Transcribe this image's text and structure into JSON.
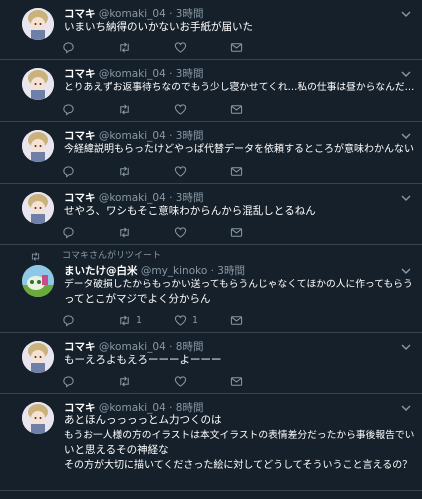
{
  "tweets": [
    {
      "name": "コマキ",
      "handle": "@komaki_04",
      "sep": "·",
      "time": "3時間",
      "lines": [
        "いまいち納得のいかないお手紙が届いた"
      ],
      "reply_count": "",
      "retweet_count": "",
      "like_count": ""
    },
    {
      "name": "コマキ",
      "handle": "@komaki_04",
      "sep": "·",
      "time": "3時間",
      "lines": [
        "とりあえずお返事待ちなのでもう少し寝かせてくれ…私の仕事は昼からなんだ…"
      ],
      "reply_count": "",
      "retweet_count": "",
      "like_count": ""
    },
    {
      "name": "コマキ",
      "handle": "@komaki_04",
      "sep": "·",
      "time": "3時間",
      "lines": [
        "今経緯説明もらったけどやっぱ代替データを依頼するところが意味わかんない"
      ],
      "reply_count": "",
      "retweet_count": "",
      "like_count": ""
    },
    {
      "name": "コマキ",
      "handle": "@komaki_04",
      "sep": "·",
      "time": "3時間",
      "lines": [
        "せやろ、ワシもそこ意味わからんから混乱しとるねん"
      ],
      "reply_count": "",
      "retweet_count": "",
      "like_count": ""
    },
    {
      "retweeted_by": "コマキさんがリツイート",
      "name": "まいたけ@白米",
      "handle": "@my_kinoko",
      "sep": "·",
      "time": "3時間",
      "lines": [
        "データ破損したからもっかい送ってもらうんじゃなくてほかの人に作ってもらう",
        "ってとこがマジでよく分からん"
      ],
      "reply_count": "",
      "retweet_count": "1",
      "like_count": "1"
    },
    {
      "name": "コマキ",
      "handle": "@komaki_04",
      "sep": "·",
      "time": "8時間",
      "lines": [
        "もーえろよもえろーーーよーーー"
      ],
      "reply_count": "",
      "retweet_count": "",
      "like_count": ""
    },
    {
      "name": "コマキ",
      "handle": "@komaki_04",
      "sep": "·",
      "time": "8時間",
      "lines": [
        "あとほんっっっっとム力つくのは",
        "もうお一人様の方のイラストは本文イラストの表情差分だったから事後報告でい",
        "いと思えるその神経な",
        "その方が大切に描いてくださった絵に対してどうしてそういうこと言えるの？"
      ],
      "reply_count": "",
      "retweet_count": "",
      "like_count": ""
    }
  ],
  "icons": {
    "caret": "chevron-down-icon",
    "reply": "reply-icon",
    "retweet": "retweet-icon",
    "like": "heart-icon",
    "dm": "mail-icon"
  },
  "colors": {
    "background": "#15202b",
    "divider": "#38444d",
    "secondary_text": "#8899a6"
  }
}
